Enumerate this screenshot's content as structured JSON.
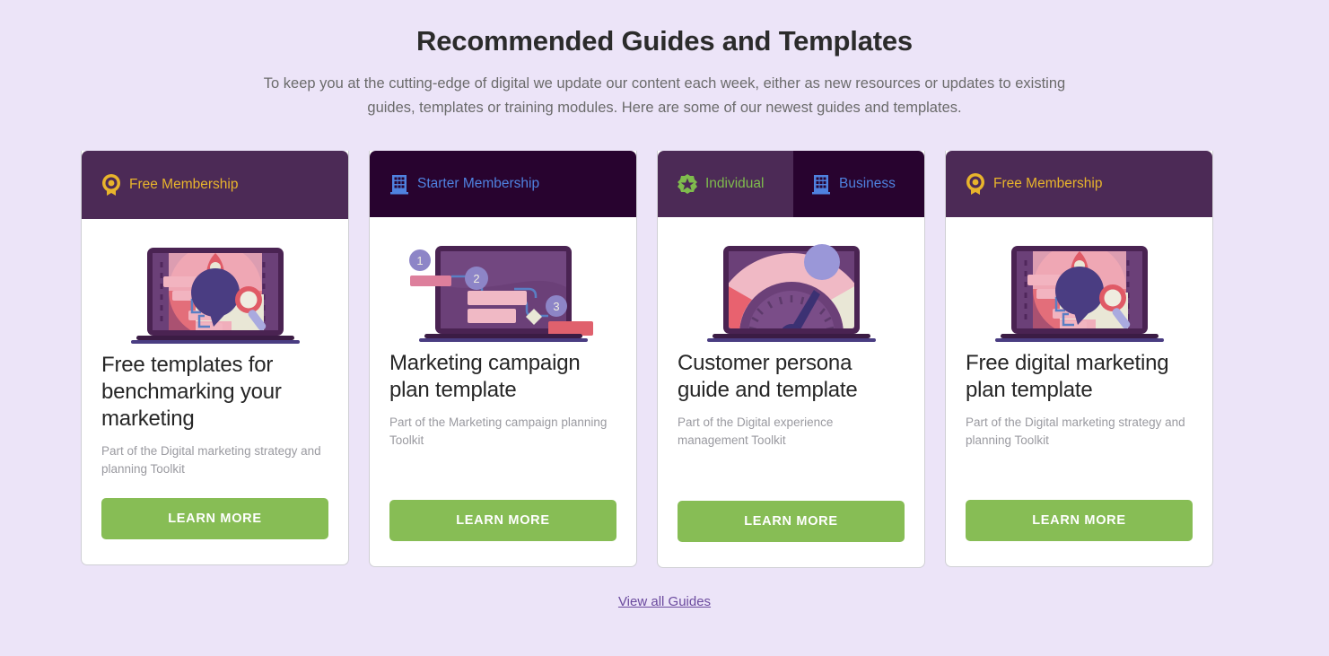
{
  "hero": {
    "title": "Recommended Guides and Templates",
    "subtitle": "To keep you at the cutting-edge of digital we update our content each week, either as new resources or updates to existing guides, templates or training modules. Here are some of our newest guides and templates."
  },
  "colors": {
    "page_background": "#ece4f8",
    "header_purple": "#4c2a56",
    "header_dark": "#28032f",
    "gold": "#e8b42c",
    "blue": "#4f82e0",
    "green": "#7fbb4d",
    "button_green": "#87bd55",
    "link_purple": "#6b4a9e",
    "card_border": "#cfcfd4"
  },
  "cards": [
    {
      "badges": [
        {
          "icon": "award-rosette-icon",
          "label": "Free Membership",
          "style": "gold"
        }
      ],
      "illustration": "laptop-rocket-speech-bubble-illustration",
      "title": "Free templates for benchmarking your marketing",
      "subtitle": "Part of the Digital marketing strategy and planning Toolkit",
      "button_label": "LEARN MORE"
    },
    {
      "badges": [
        {
          "icon": "building-icon",
          "label": "Starter Membership",
          "style": "blue"
        }
      ],
      "illustration": "laptop-flowchart-illustration",
      "title": "Marketing campaign plan template",
      "subtitle": "Part of the Marketing campaign planning Toolkit",
      "button_label": "LEARN MORE"
    },
    {
      "badges": [
        {
          "icon": "star-rosette-icon",
          "label": "Individual",
          "style": "green"
        },
        {
          "icon": "building-icon",
          "label": "Business",
          "style": "blue"
        }
      ],
      "illustration": "laptop-speedometer-illustration",
      "title": "Customer persona guide and template",
      "subtitle": "Part of the Digital experience management Toolkit",
      "button_label": "LEARN MORE"
    },
    {
      "badges": [
        {
          "icon": "award-rosette-icon",
          "label": "Free Membership",
          "style": "gold"
        }
      ],
      "illustration": "laptop-rocket-speech-bubble-illustration",
      "title": "Free digital marketing plan template",
      "subtitle": "Part of the Digital marketing strategy and planning Toolkit",
      "button_label": "LEARN MORE"
    }
  ],
  "footer": {
    "view_all_label": "View all Guides"
  }
}
